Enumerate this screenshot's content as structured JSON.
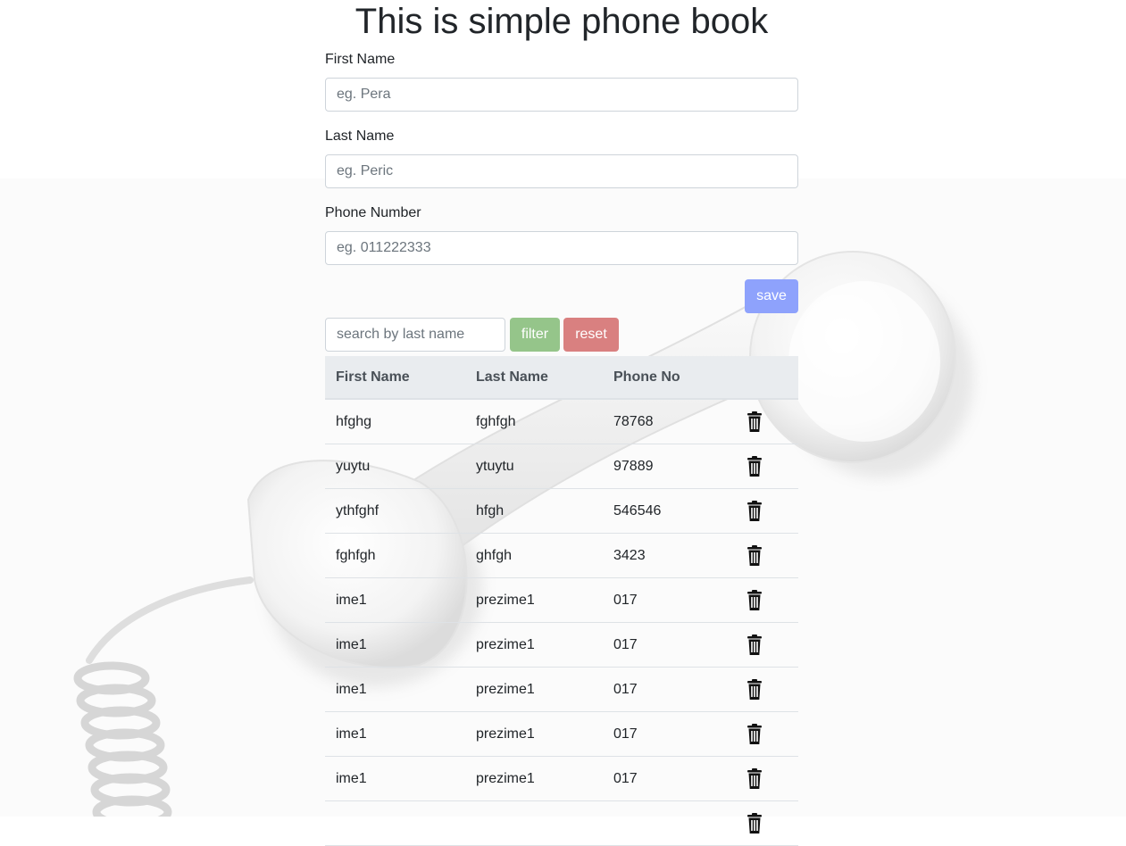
{
  "title": "This is simple phone book",
  "form": {
    "first_name_label": "First Name",
    "first_name_placeholder": "eg. Pera",
    "last_name_label": "Last Name",
    "last_name_placeholder": "eg. Peric",
    "phone_label": "Phone Number",
    "phone_placeholder": "eg. 011222333",
    "save_label": "save"
  },
  "search": {
    "placeholder": "search by last name",
    "filter_label": "filter",
    "reset_label": "reset"
  },
  "table": {
    "headers": [
      "First Name",
      "Last Name",
      "Phone No"
    ],
    "rows": [
      {
        "first": "hfghg",
        "last": "fghfgh",
        "phone": "78768"
      },
      {
        "first": "yuytu",
        "last": "ytuytu",
        "phone": "97889"
      },
      {
        "first": "ythfghf",
        "last": "hfgh",
        "phone": "546546"
      },
      {
        "first": "fghfgh",
        "last": "ghfgh",
        "phone": "3423"
      },
      {
        "first": "ime1",
        "last": "prezime1",
        "phone": "017"
      },
      {
        "first": "ime1",
        "last": "prezime1",
        "phone": "017"
      },
      {
        "first": "ime1",
        "last": "prezime1",
        "phone": "017"
      },
      {
        "first": "ime1",
        "last": "prezime1",
        "phone": "017"
      },
      {
        "first": "ime1",
        "last": "prezime1",
        "phone": "017"
      },
      {
        "first": "",
        "last": "",
        "phone": ""
      }
    ]
  },
  "icons": {
    "delete": "trash-icon",
    "background": "phone-handset-image"
  },
  "colors": {
    "save": "#8ea2fc",
    "filter": "#95c58a",
    "reset": "#d98080",
    "header_bg": "#e9ecef"
  }
}
